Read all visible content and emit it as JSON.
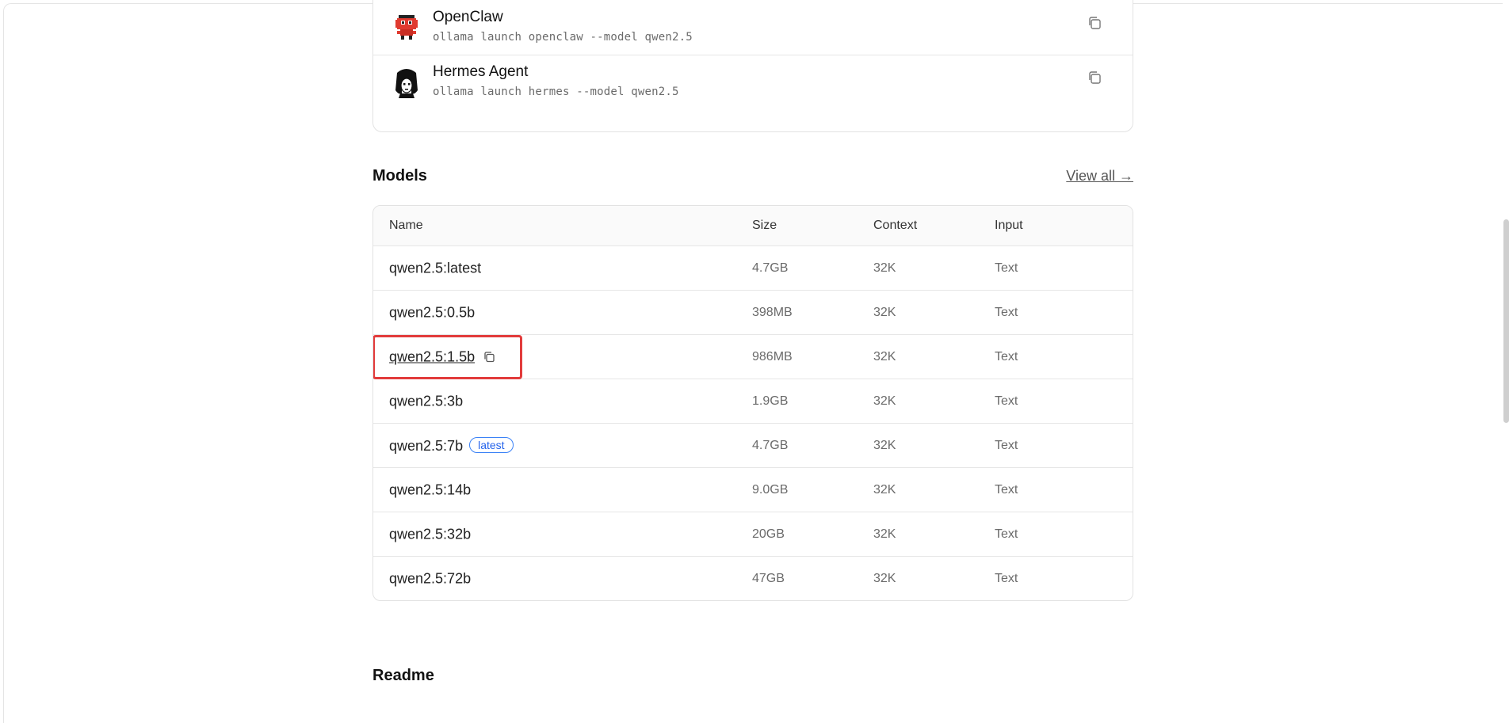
{
  "integrations": [
    {
      "name": "OpenClaw",
      "command": "ollama launch openclaw --model qwen2.5",
      "icon": "openclaw-robot-icon"
    },
    {
      "name": "Hermes Agent",
      "command": "ollama launch hermes --model qwen2.5",
      "icon": "hermes-agent-avatar-icon"
    }
  ],
  "models": {
    "title": "Models",
    "view_all": "View all →",
    "columns": {
      "name": "Name",
      "size": "Size",
      "context": "Context",
      "input": "Input"
    },
    "rows": [
      {
        "name": "qwen2.5:latest",
        "size": "4.7GB",
        "context": "32K",
        "input": "Text"
      },
      {
        "name": "qwen2.5:0.5b",
        "size": "398MB",
        "context": "32K",
        "input": "Text"
      },
      {
        "name": "qwen2.5:1.5b",
        "size": "986MB",
        "context": "32K",
        "input": "Text"
      },
      {
        "name": "qwen2.5:3b",
        "size": "1.9GB",
        "context": "32K",
        "input": "Text"
      },
      {
        "name": "qwen2.5:7b",
        "badge": "latest",
        "size": "4.7GB",
        "context": "32K",
        "input": "Text"
      },
      {
        "name": "qwen2.5:14b",
        "size": "9.0GB",
        "context": "32K",
        "input": "Text"
      },
      {
        "name": "qwen2.5:32b",
        "size": "20GB",
        "context": "32K",
        "input": "Text"
      },
      {
        "name": "qwen2.5:72b",
        "size": "47GB",
        "context": "32K",
        "input": "Text"
      }
    ]
  },
  "readme": {
    "title": "Readme"
  },
  "colors": {
    "highlight": "#e23b3b",
    "badge": "#2563eb"
  }
}
